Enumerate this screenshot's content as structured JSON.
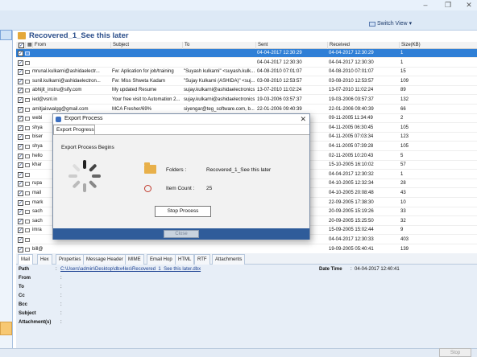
{
  "window": {
    "switch_view": "Switch View"
  },
  "heading": {
    "title": "Recovered_1_See this later"
  },
  "columns": [
    "From",
    "Subject",
    "To",
    "Sent",
    "Received",
    "Size(KB)"
  ],
  "rows": [
    {
      "from": "",
      "subject": "",
      "to": "",
      "sent": "04-04-2017 12:30:29",
      "received": "04-04-2017 12:30:29",
      "size": "1"
    },
    {
      "from": "",
      "subject": "",
      "to": "",
      "sent": "04-04-2017 12:30:30",
      "received": "04-04-2017 12:30:30",
      "size": "1"
    },
    {
      "from": "mrunal.kulkarni@ashidaelectr...",
      "subject": "Fw: Aplication for job/training",
      "to": "\"Suyash kulkarni\" <suyash.kulk...",
      "sent": "04-08-2010 07:01:07",
      "received": "04-08-2010 07:01:07",
      "size": "15"
    },
    {
      "from": "sunil.kulkarni@ashidaelectron...",
      "subject": "Fw: Miss Shweta Kadam",
      "to": "\"Sujay Kulkarni (ASHIDA)\" <suj...",
      "sent": "03-08-2010 12:53:57",
      "received": "03-08-2010 12:53:57",
      "size": "109"
    },
    {
      "from": "abhijit_instru@sify.com",
      "subject": "My updated Resume",
      "to": "sujay.kulkarni@ashidaelectronics.com",
      "sent": "13-07-2010 11:02:24",
      "received": "13-07-2010 11:02:24",
      "size": "89"
    },
    {
      "from": "ied@vsnl.in",
      "subject": "Your free visit to Automation 2...",
      "to": "sujay.kulkarni@ashidaelectronics.com",
      "sent": "19-03-2006 03:57:37",
      "received": "19-03-2006 03:57:37",
      "size": "132"
    },
    {
      "from": "amitjaiswalgg@gmail.com",
      "subject": "MCA Fresher/69%",
      "to": "siyengar@teg_software.com, b...",
      "sent": "22-01-2006 09:40:39",
      "received": "22-01-2006 09:40:39",
      "size": "66"
    },
    {
      "from": "webi",
      "subject": "",
      "to": "",
      "sent": "",
      "received": "09-11-2005 11:34:49",
      "size": "2"
    },
    {
      "from": "shya",
      "subject": "",
      "to": "",
      "sent": "",
      "received": "04-11-2005 06:30:45",
      "size": "105"
    },
    {
      "from": "biser",
      "subject": "",
      "to": "",
      "sent": "",
      "received": "04-11-2005 07:03:34",
      "size": "123"
    },
    {
      "from": "shya",
      "subject": "",
      "to": "",
      "sent": "",
      "received": "04-11-2005 07:39:28",
      "size": "105"
    },
    {
      "from": "hello",
      "subject": "",
      "to": "",
      "sent": "",
      "received": "02-11-2005 10:20:43",
      "size": "5"
    },
    {
      "from": "khar",
      "subject": "",
      "to": "",
      "sent": "",
      "received": "15-10-2005 16:10:02",
      "size": "57"
    },
    {
      "from": "",
      "subject": "",
      "to": "",
      "sent": "",
      "received": "04-04-2017 12:30:32",
      "size": "1"
    },
    {
      "from": "rupa",
      "subject": "",
      "to": "",
      "sent": "",
      "received": "04-10-2005 12:32:34",
      "size": "28"
    },
    {
      "from": "mail",
      "subject": "",
      "to": "",
      "sent": "",
      "received": "04-10-2005 20:08:48",
      "size": "43"
    },
    {
      "from": "mark",
      "subject": "",
      "to": "",
      "sent": "",
      "received": "22-09-2005 17:38:30",
      "size": "10"
    },
    {
      "from": "sach",
      "subject": "",
      "to": "",
      "sent": "",
      "received": "20-09-2005 15:19:26",
      "size": "33"
    },
    {
      "from": "sach",
      "subject": "",
      "to": "",
      "sent": "",
      "received": "20-09-2005 15:25:50",
      "size": "32"
    },
    {
      "from": "imra",
      "subject": "",
      "to": "",
      "sent": "",
      "received": "15-09-2005 15:02:44",
      "size": "9"
    },
    {
      "from": "",
      "subject": "",
      "to": "",
      "sent": "",
      "received": "04-04-2017 12:30:33",
      "size": "403"
    },
    {
      "from": "bill@",
      "subject": "",
      "to": "",
      "sent": "",
      "received": "19-09-2005 05:40:41",
      "size": "139"
    }
  ],
  "tabs": [
    "Mail",
    "Hex",
    "Properties",
    "Message Header",
    "MIME",
    "Email Hop",
    "HTML",
    "RTF",
    "Attachments"
  ],
  "preview": {
    "path_label": "Path",
    "path_value": "C:\\Users\\admin\\Desktop\\dbx4les\\Recovered_1_See this later.dbx",
    "datetime_label": "Date Time",
    "datetime_value": "04-04-2017 12:40:41",
    "from_label": "From",
    "to_label": "To",
    "cc_label": "Cc",
    "bcc_label": "Bcc",
    "subject_label": "Subject",
    "attachments_label": "Attachment(s)",
    "colon": ":"
  },
  "bottom": {
    "stop_label": "Stop"
  },
  "dialog": {
    "title": "Export Process",
    "tab": "Export Progress",
    "begins": "Export Process Begins",
    "folders_label": "Folders :",
    "folders_value": "Recovered_1_See this later",
    "item_count_label": "Item Count :",
    "item_count_value": "25",
    "stop_process": "Stop Process",
    "close": "Close"
  },
  "colors": {
    "accent": "#2f7fd6",
    "dialog_footer": "#2f5c9a"
  }
}
